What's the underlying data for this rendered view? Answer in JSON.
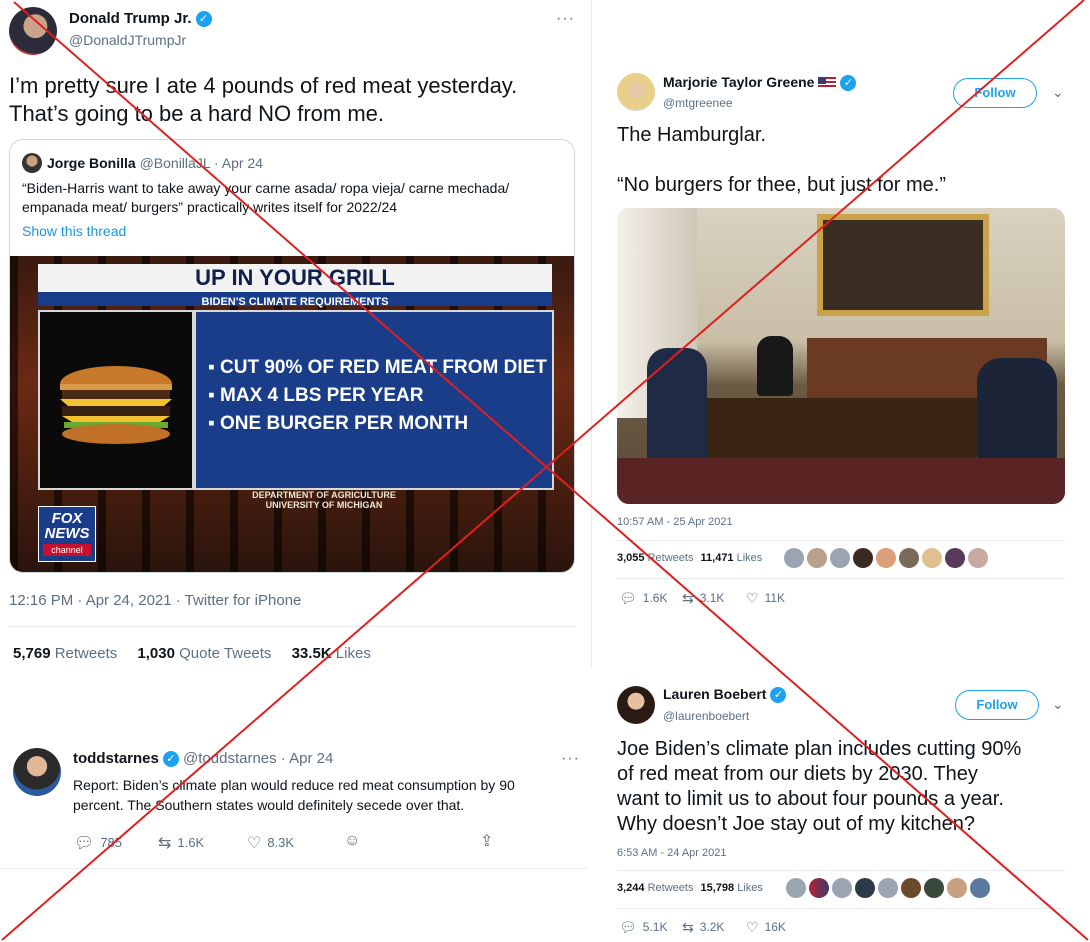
{
  "tweet1": {
    "name": "Donald Trump Jr.",
    "handle": "@DonaldJTrumpJr",
    "more": "···",
    "text_line1": "I’m pretty sure I ate 4 pounds of red meat yesterday.",
    "text_line2": "That’s going to be a hard NO from me.",
    "quote": {
      "name": "Jorge Bonilla",
      "handle_date": "@BonillaJL · Apr 24",
      "text_line1": "“Biden-Harris want to take away your carne asada/ ropa vieja/ carne mechada/",
      "text_line2": "empanada meat/ burgers” practically writes itself for 2022/24",
      "show_thread": "Show this thread",
      "image": {
        "headline": "UP IN YOUR GRILL",
        "subhead": "BIDEN'S CLIMATE REQUIREMENTS",
        "bullets": [
          "CUT 90% OF RED MEAT FROM DIET",
          "MAX 4 LBS PER YEAR",
          "ONE BURGER PER MONTH"
        ],
        "source_line1": "DEPARTMENT OF AGRICULTURE",
        "source_line2": "UNIVERSITY OF MICHIGAN",
        "logo_line1": "FOX",
        "logo_line2": "NEWS",
        "logo_line3": "channel"
      }
    },
    "timestamp": "12:16 PM · Apr 24, 2021 · Twitter for iPhone",
    "stats": {
      "retweets_num": "5,769",
      "retweets_label": "Retweets",
      "quotes_num": "1,030",
      "quotes_label": "Quote Tweets",
      "likes_num": "33.5K",
      "likes_label": "Likes"
    }
  },
  "tweet2": {
    "name": "Marjorie Taylor Greene",
    "handle": "@mtgreenee",
    "follow": "Follow",
    "text_line1": "The Hamburglar.",
    "text_line2": "“No burgers for thee, but just for me.”",
    "timestamp": "10:57 AM - 25 Apr 2021",
    "retweets_num": "3,055",
    "retweets_label": "Retweets",
    "likes_num": "11,471",
    "likes_label": "Likes",
    "replies": "1.6K",
    "rts": "3.1K",
    "likes": "11K"
  },
  "tweet3": {
    "name": "toddstarnes",
    "handle_date": "@toddstarnes · Apr 24",
    "more": "···",
    "text_line1": "Report: Biden’s climate plan would reduce red meat consumption by 90",
    "text_line2": "percent. The Southern states would definitely secede over that.",
    "replies": "785",
    "rts": "1.6K",
    "likes": "8.3K"
  },
  "tweet4": {
    "name": "Lauren Boebert",
    "handle": "@laurenboebert",
    "follow": "Follow",
    "text_line1": "Joe Biden’s climate plan includes cutting 90%",
    "text_line2": "of red meat from our diets by 2030. They",
    "text_line3": "want to limit us to about four pounds a year.",
    "text_line4": "Why doesn’t Joe stay out of my kitchen?",
    "timestamp": "6:53 AM - 24 Apr 2021",
    "retweets_num": "3,244",
    "retweets_label": "Retweets",
    "likes_num": "15,798",
    "likes_label": "Likes",
    "replies": "5.1K",
    "rts": "3.2K",
    "likes": "16K"
  },
  "colors": {
    "accent": "#1da1f2",
    "cross": "#e02020",
    "fox_blue": "#1a3d8a"
  },
  "icons": [
    "verified-badge-icon",
    "more-icon",
    "chevron-down-icon",
    "reply-icon",
    "retweet-icon",
    "like-icon",
    "share-icon",
    "react-icon"
  ]
}
